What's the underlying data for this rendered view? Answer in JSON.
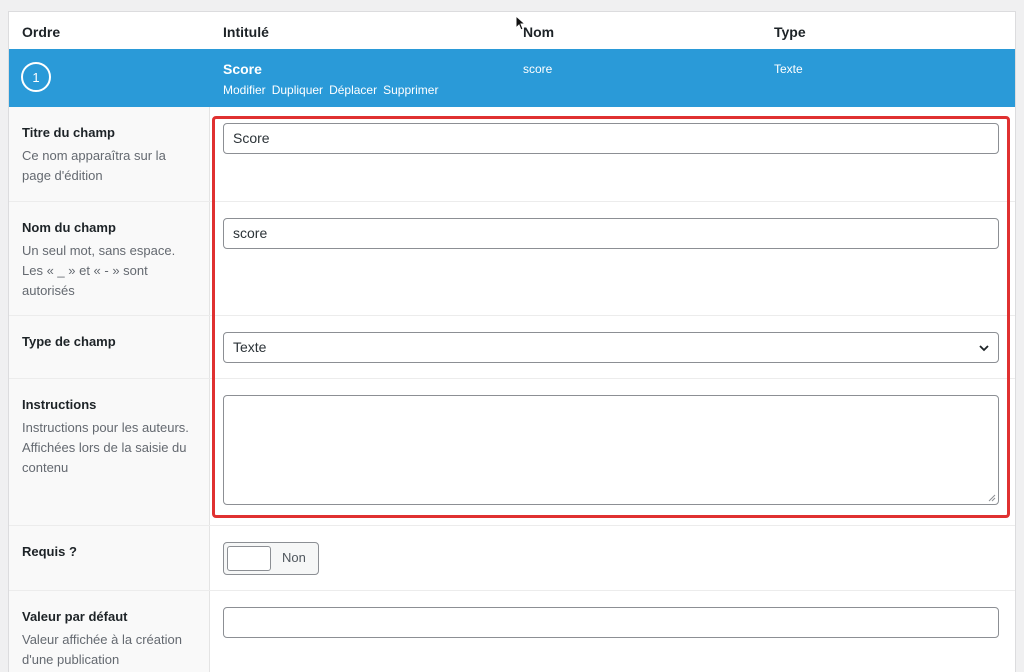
{
  "table_header": {
    "order": "Ordre",
    "label": "Intitulé",
    "name": "Nom",
    "type": "Type"
  },
  "field": {
    "order": "1",
    "label": "Score",
    "name": "score",
    "type": "Texte",
    "actions": {
      "edit": "Modifier",
      "duplicate": "Dupliquer",
      "move": "Déplacer",
      "delete": "Supprimer"
    }
  },
  "settings": {
    "title": {
      "label": "Titre du champ",
      "description": "Ce nom apparaîtra sur la page d'édition",
      "value": "Score"
    },
    "name": {
      "label": "Nom du champ",
      "description": "Un seul mot, sans espace. Les « _ » et « - » sont autorisés",
      "value": "score"
    },
    "type": {
      "label": "Type de champ",
      "selected": "Texte"
    },
    "instructions": {
      "label": "Instructions",
      "description": "Instructions pour les auteurs. Affichées lors de la saisie du contenu",
      "value": ""
    },
    "required": {
      "label": "Requis ?",
      "toggle_text": "Non"
    },
    "default_value": {
      "label": "Valeur par défaut",
      "description": "Valeur affichée à la création d'une publication",
      "value": ""
    }
  },
  "colors": {
    "accent": "#2a9ad8",
    "highlight": "#e03131"
  }
}
